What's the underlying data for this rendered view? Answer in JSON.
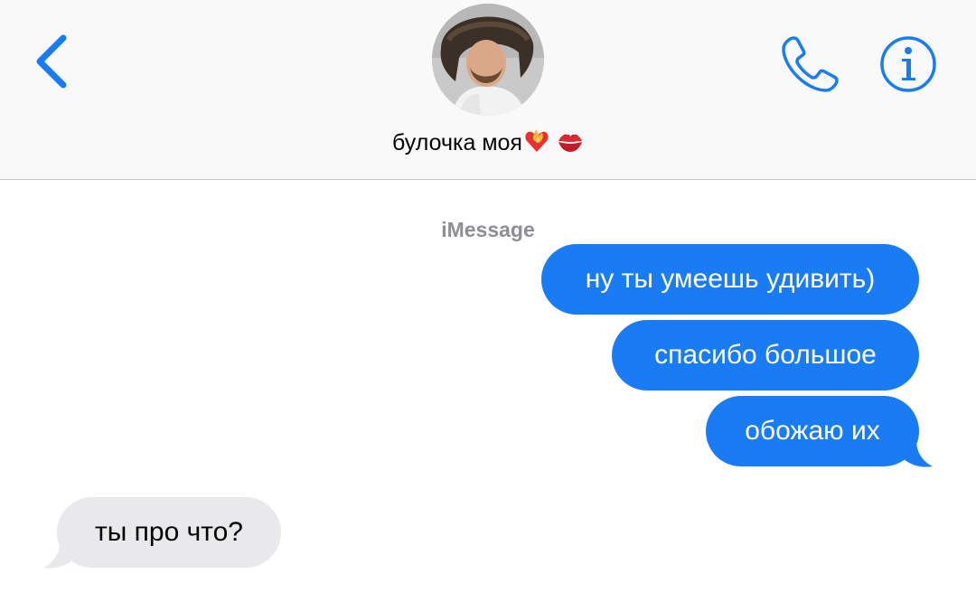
{
  "header": {
    "contact_name": "булочка моя",
    "name_emojis": [
      "heart-on-fire-emoji",
      "kiss-mark-emoji"
    ],
    "back_icon": "chevron-left-icon",
    "call_icon": "phone-icon",
    "info_icon": "info-icon"
  },
  "conversation": {
    "service_label": "iMessage",
    "messages": [
      {
        "direction": "outgoing",
        "text": "ну ты умеешь удивить)"
      },
      {
        "direction": "outgoing",
        "text": "спасибо большое"
      },
      {
        "direction": "outgoing",
        "text": "обожаю их"
      },
      {
        "direction": "incoming",
        "text": "ты про что?"
      }
    ]
  },
  "colors": {
    "accent": "#1a7cf5",
    "outgoing_bubble": "#1a7cf5",
    "incoming_bubble": "#e9e9eb",
    "header_background": "#f9f9f9",
    "secondary_text": "#8e8e93"
  }
}
